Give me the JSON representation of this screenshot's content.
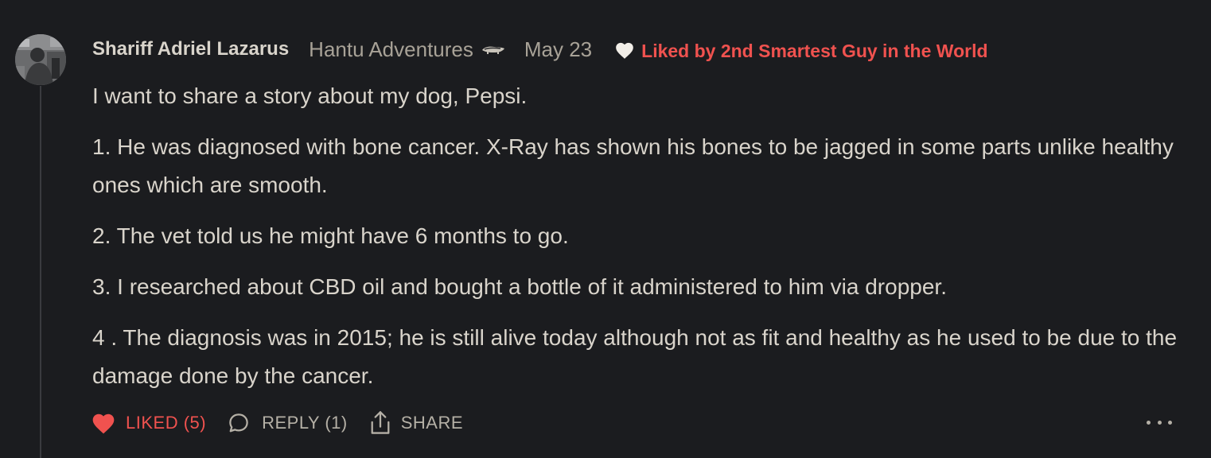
{
  "comment": {
    "author": "Shariff Adriel Lazarus",
    "publication": "Hantu Adventures",
    "publication_icon": "badger-icon",
    "date": "May 23",
    "liked_by": "Liked by 2nd Smartest Guy in the World",
    "paragraphs": [
      "I want to share a story about my dog, Pepsi.",
      "1. He was diagnosed with bone cancer. X-Ray has shown his bones to be jagged in some parts unlike healthy ones which are smooth.",
      "2. The vet told us he might have 6 months to go.",
      "3. I researched about CBD oil and bought a bottle of it administered to him via dropper.",
      "4 . The diagnosis was in 2015; he is still alive today although not as fit and healthy as he used to be due to the damage done by the cancer."
    ]
  },
  "actions": {
    "like_label": "LIKED (5)",
    "reply_label": "REPLY (1)",
    "share_label": "SHARE"
  },
  "colors": {
    "background": "#1b1c1f",
    "text": "#d9d4cb",
    "muted": "#a8a297",
    "accent_red": "#f0524f"
  }
}
